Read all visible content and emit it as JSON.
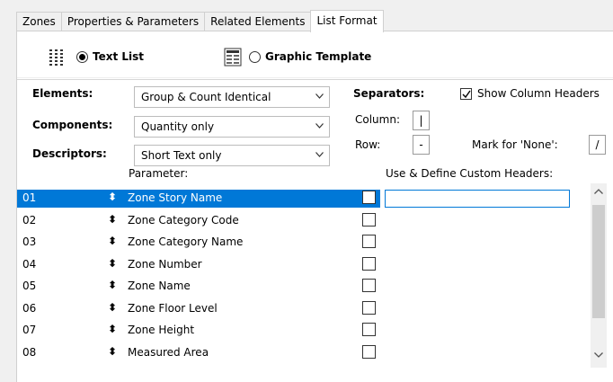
{
  "tabs": [
    {
      "label": "Zones"
    },
    {
      "label": "Properties & Parameters"
    },
    {
      "label": "Related Elements"
    },
    {
      "label": "List Format"
    }
  ],
  "mode": {
    "text_list": "Text List",
    "graphic_template": "Graphic Template",
    "selected": "Text List"
  },
  "elements": {
    "label": "Elements:",
    "value": "Group & Count Identical"
  },
  "components": {
    "label": "Components:",
    "value": "Quantity only"
  },
  "descriptors": {
    "label": "Descriptors:",
    "value": "Short Text only"
  },
  "separators": {
    "label": "Separators:",
    "show_headers": "Show Column Headers",
    "show_headers_checked": true,
    "column_label": "Column:",
    "column_value": "|",
    "row_label": "Row:",
    "row_value": "-",
    "none_label": "Mark for 'None':",
    "none_value": "/"
  },
  "table": {
    "parameter_header": "Parameter:",
    "custom_header": "Use & Define Custom Headers:",
    "rows": [
      {
        "num": "01",
        "name": "Zone Story Name"
      },
      {
        "num": "02",
        "name": "Zone Category Code"
      },
      {
        "num": "03",
        "name": "Zone Category Name"
      },
      {
        "num": "04",
        "name": "Zone Number"
      },
      {
        "num": "05",
        "name": "Zone Name"
      },
      {
        "num": "06",
        "name": "Zone Floor Level"
      },
      {
        "num": "07",
        "name": "Zone Height"
      },
      {
        "num": "08",
        "name": "Measured Area"
      }
    ],
    "selected_row": 0
  },
  "icons": {
    "list_view": "text-list-icon",
    "template": "graphic-template-icon",
    "reorder": "up-down-arrows-icon",
    "dropdown": "chevron-down-icon"
  },
  "colors": {
    "selection": "#0078d7",
    "panel": "#ffffff",
    "background": "#f0f0f0"
  }
}
